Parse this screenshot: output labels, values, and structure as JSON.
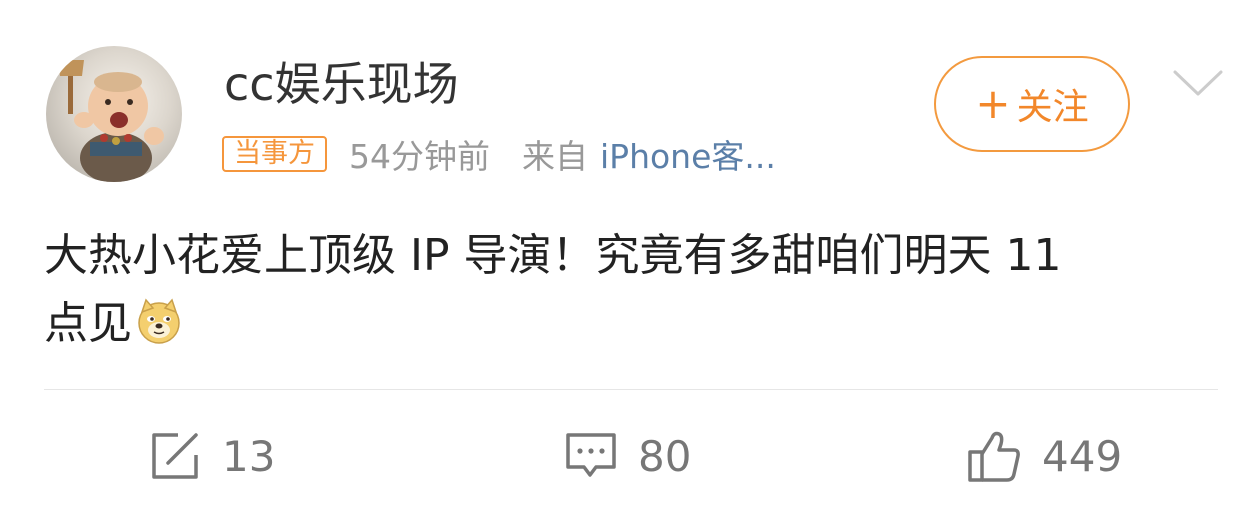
{
  "post": {
    "username": "cc娱乐现场",
    "badge": "当事方",
    "time": "54分钟前",
    "source_prefix": "来自",
    "source_link": "iPhone客...",
    "follow_label": "关注",
    "follow_plus": "+",
    "content_line1": "大热小花爱上顶级 IP 导演！究竟有多甜咱们明天 11",
    "content_line2": "点见",
    "emoji": "doge-emoji"
  },
  "actions": {
    "repost_count": "13",
    "comment_count": "80",
    "like_count": "449"
  },
  "icons": {
    "avatar": "avatar-image",
    "repost": "repost-icon",
    "comment": "comment-icon",
    "like": "thumbs-up-icon",
    "menu": "chevron-down-icon"
  },
  "colors": {
    "accent": "#f2872a",
    "meta": "#999999",
    "link": "#5b7fa8",
    "text": "#222222",
    "icon": "#777777"
  }
}
